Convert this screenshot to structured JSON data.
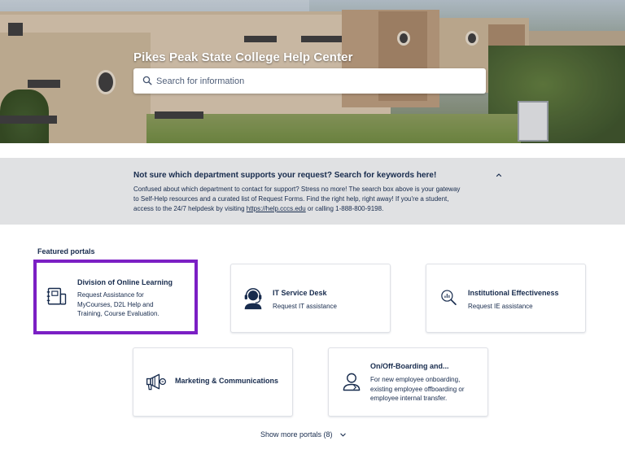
{
  "hero": {
    "title": "Pikes Peak State College Help Center",
    "search_placeholder": "Search for information"
  },
  "notice": {
    "title": "Not sure which department supports your request? Search for keywords here!",
    "body_line1": "Confused about which department to contact for support? Stress no more! The search box above is your gateway",
    "body_line2": "to Self-Help resources and a curated list of Request Forms. Find the right help, right away! If you're a student,",
    "body_line3_pre": "access to the 24/7 helpdesk by visiting ",
    "body_link": "https://help.cccs.edu",
    "body_line3_post": " or calling 1-888-800-9198."
  },
  "featured": {
    "heading": "Featured portals",
    "cards": [
      {
        "title": "Division of Online Learning",
        "desc": "Request Assistance for MyCourses, D2L Help and Training, Course Evaluation.",
        "desc_lines": [
          "Request Assistance for",
          "MyCourses, D2L Help and",
          "Training, Course Evaluation."
        ],
        "icon": "notebook-icon"
      },
      {
        "title": "IT Service Desk",
        "desc": "Request IT assistance",
        "icon": "headset-agent-icon"
      },
      {
        "title": "Institutional Effectiveness",
        "desc": "Request IE assistance",
        "icon": "magnifier-chart-icon"
      },
      {
        "title": "Marketing & Communications",
        "desc": "",
        "icon": "megaphone-icon"
      },
      {
        "title": "On/Off-Boarding and...",
        "desc": "For new employee onboarding, existing employee offboarding or employee internal transfer.",
        "desc_lines": [
          "For new employee onboarding,",
          "existing employee offboarding or",
          "employee internal transfer."
        ],
        "icon": "person-outline-icon"
      }
    ],
    "highlight_color": "#7b1fc4"
  },
  "show_more": {
    "label": "Show more portals (8)"
  }
}
